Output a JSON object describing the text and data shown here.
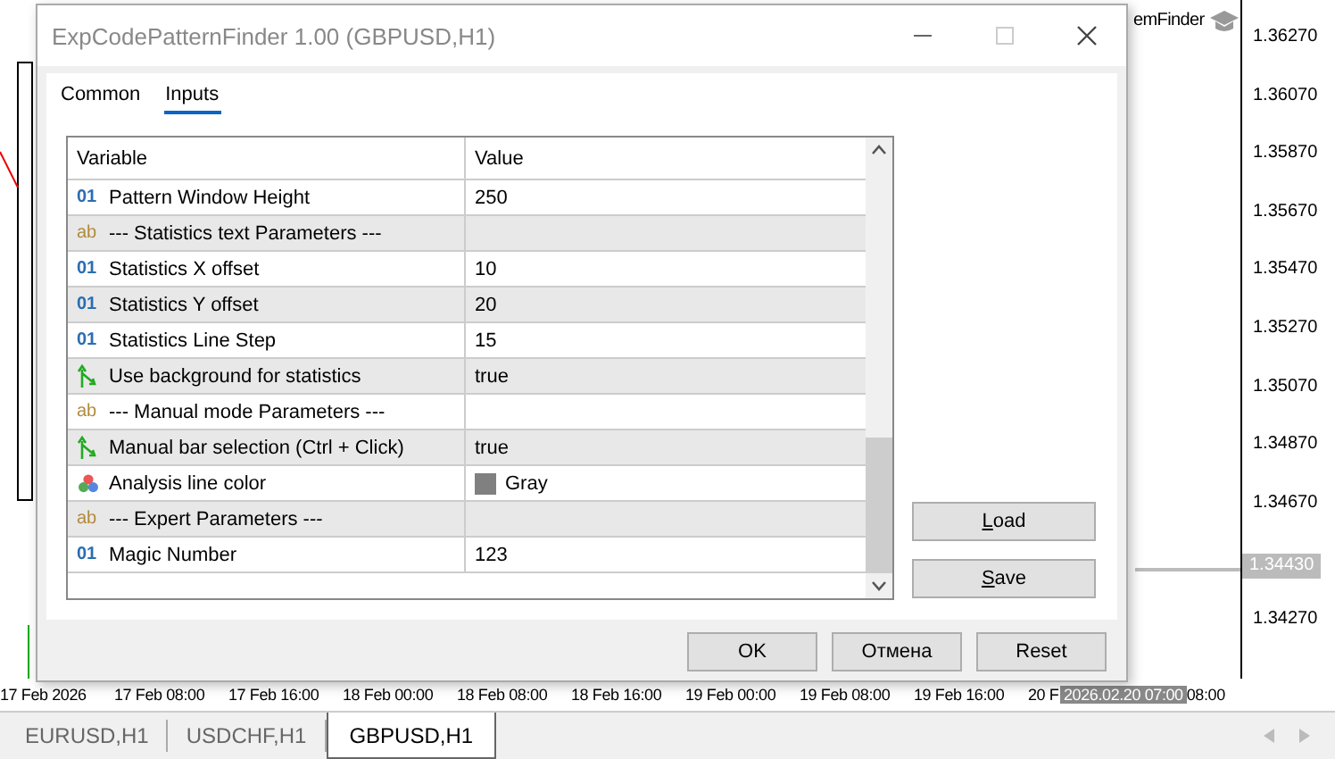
{
  "chart": {
    "expert_label": "emFinder",
    "price_axis": [
      {
        "kind": "tick",
        "text": "1.36270"
      },
      {
        "kind": "tick",
        "text": "1.36070"
      },
      {
        "kind": "tick",
        "text": "1.35870"
      },
      {
        "kind": "tick",
        "text": "1.35670"
      },
      {
        "kind": "tick",
        "text": "1.35470"
      },
      {
        "kind": "tick",
        "text": "1.35270"
      },
      {
        "kind": "tick",
        "text": "1.35070"
      },
      {
        "kind": "tick",
        "text": "1.34870"
      },
      {
        "kind": "tick",
        "text": "1.34670"
      },
      {
        "kind": "current",
        "text": "1.34430"
      },
      {
        "kind": "tick",
        "text": "1.34270"
      }
    ],
    "time_axis": [
      {
        "kind": "tick",
        "text": "17 Feb 2026"
      },
      {
        "kind": "tick",
        "text": "17 Feb 08:00"
      },
      {
        "kind": "tick",
        "text": "17 Feb 16:00"
      },
      {
        "kind": "tick",
        "text": "18 Feb 00:00"
      },
      {
        "kind": "tick",
        "text": "18 Feb 08:00"
      },
      {
        "kind": "tick",
        "text": "18 Feb 16:00"
      },
      {
        "kind": "tick",
        "text": "19 Feb 00:00"
      },
      {
        "kind": "tick",
        "text": "19 Feb 08:00"
      },
      {
        "kind": "tick",
        "text": "19 Feb 16:00"
      },
      {
        "kind": "tick",
        "text": "20 F"
      },
      {
        "kind": "current",
        "text": "2026.02.20 07:00"
      },
      {
        "kind": "tick",
        "text": "08:00"
      }
    ]
  },
  "dialog": {
    "title": "ExpCodePatternFinder 1.00 (GBPUSD,H1)",
    "tabs": [
      {
        "label": "Common",
        "selected": false
      },
      {
        "label": "Inputs",
        "selected": true
      }
    ],
    "table": {
      "columns": [
        "Variable",
        "Value"
      ],
      "rows": [
        {
          "kind": "int",
          "badge": "01",
          "variable": "Pattern Window Height",
          "value": "250"
        },
        {
          "kind": "string",
          "badge": "ab",
          "variable": "--- Statistics text Parameters ---",
          "value": ""
        },
        {
          "kind": "int",
          "badge": "01",
          "variable": "Statistics X offset",
          "value": "10"
        },
        {
          "kind": "int",
          "badge": "01",
          "variable": "Statistics Y offset",
          "value": "20"
        },
        {
          "kind": "int",
          "badge": "01",
          "variable": "Statistics Line Step",
          "value": "15"
        },
        {
          "kind": "bool",
          "variable": "Use background for statistics",
          "value": "true"
        },
        {
          "kind": "string",
          "badge": "ab",
          "variable": "--- Manual mode Parameters ---",
          "value": ""
        },
        {
          "kind": "bool",
          "variable": "Manual bar selection (Ctrl + Click)",
          "value": "true"
        },
        {
          "kind": "color",
          "variable": "Analysis line color",
          "value": "Gray",
          "color": "#808080"
        },
        {
          "kind": "string",
          "badge": "ab",
          "variable": "--- Expert Parameters ---",
          "value": ""
        },
        {
          "kind": "int",
          "badge": "01",
          "variable": "Magic Number",
          "value": "123"
        }
      ]
    },
    "side_buttons": [
      "Load",
      "Save"
    ],
    "buttons": [
      "OK",
      "Отмена",
      "Reset"
    ]
  },
  "symbol_tabs": [
    {
      "label": "EURUSD,H1",
      "selected": false
    },
    {
      "label": "USDCHF,H1",
      "selected": false
    },
    {
      "label": "GBPUSD,H1",
      "selected": true
    }
  ]
}
